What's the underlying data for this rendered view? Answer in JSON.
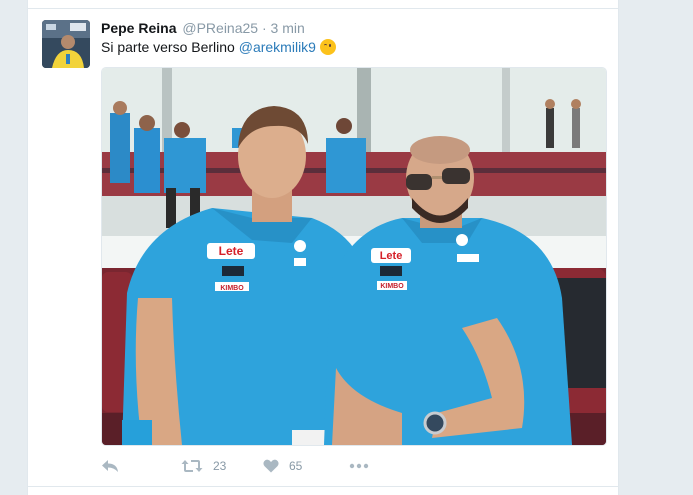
{
  "tweet": {
    "author_name": "Pepe Reina",
    "author_handle": "@PReina25",
    "separator": "·",
    "time": "3 min",
    "text": "Si parte verso Berlino",
    "mention": "@arekmilik9",
    "emoji": "winking-face"
  },
  "photo": {
    "shirt_sponsor": "Lete",
    "shirt_secondary": "KIMBO",
    "shirt_brand": "Kappa",
    "colors": {
      "shirt": "#2ea3dc",
      "seat": "#8c2a34",
      "window": "#e8f0f2"
    }
  },
  "actions": {
    "reply_icon": "reply-icon",
    "retweet_icon": "retweet-icon",
    "retweet_count": "23",
    "like_icon": "heart-icon",
    "like_count": "65",
    "more_icon": "more-icon"
  },
  "colors": {
    "link": "#2b7bb9",
    "muted": "#8899a6",
    "text": "#14171a",
    "background": "#e6ecf0"
  }
}
